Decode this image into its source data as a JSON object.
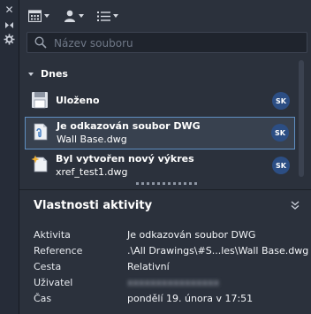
{
  "search": {
    "placeholder": "Název souboru"
  },
  "group": {
    "label": "Dnes"
  },
  "activities": [
    {
      "title": "Uloženo",
      "subtitle": "",
      "user": "SK",
      "icon": "save-icon"
    },
    {
      "title": "Je odkazován soubor DWG",
      "subtitle": "Wall Base.dwg",
      "user": "SK",
      "icon": "xref-drawing-icon",
      "selected": true
    },
    {
      "title": "Byl vytvořen nový výkres",
      "subtitle": "xref_test1.dwg",
      "user": "SK",
      "icon": "new-drawing-icon"
    }
  ],
  "properties": {
    "title": "Vlastnosti aktivity",
    "rows": [
      {
        "label": "Aktivita",
        "value": "Je odkazován soubor DWG"
      },
      {
        "label": "Reference",
        "value": ".\\All Drawings\\#S...les\\Wall Base.dwg"
      },
      {
        "label": "Cesta",
        "value": "Relativní"
      },
      {
        "label": "Uživatel",
        "value": "xxxxxxxxxxxxxxxx"
      },
      {
        "label": "Čas",
        "value": "pondělí 19. února v 17:51"
      }
    ]
  },
  "colors": {
    "accent": "#5f8fc2",
    "avatar": "#2c4e84",
    "panel": "#2b313c"
  }
}
